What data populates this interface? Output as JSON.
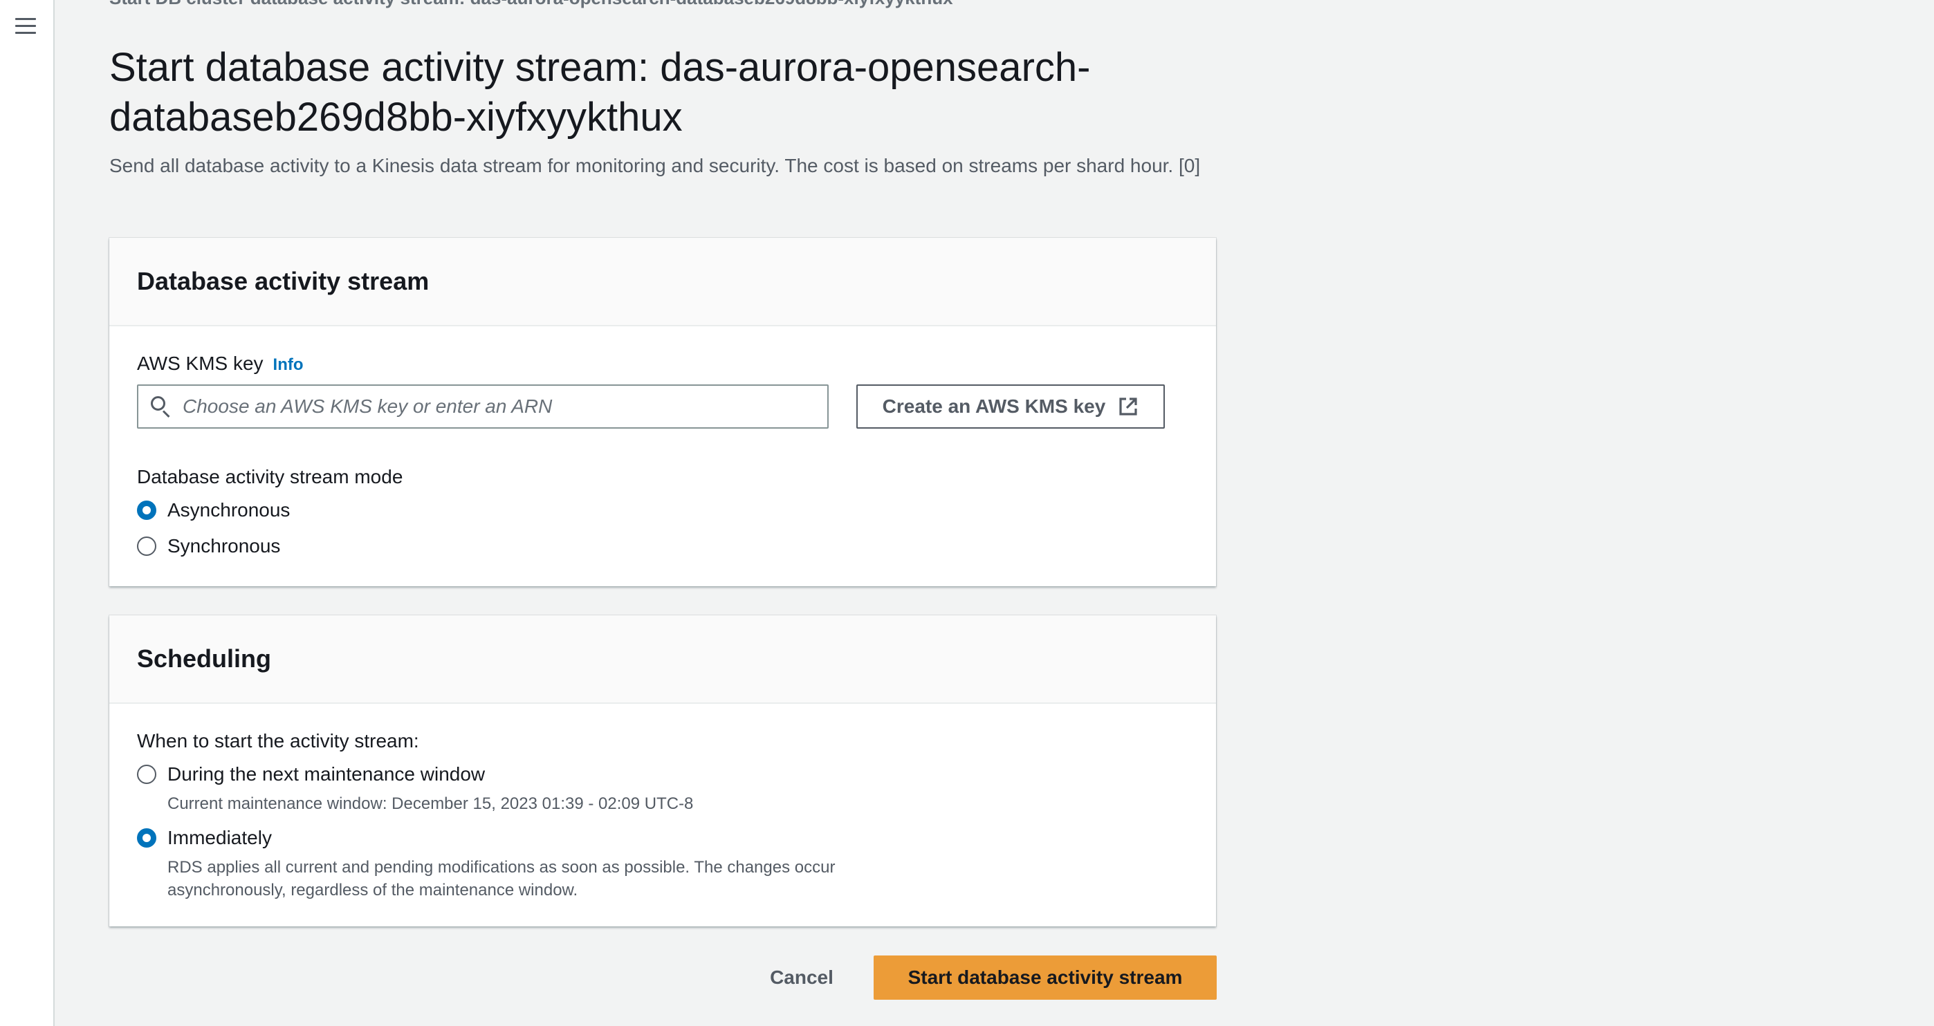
{
  "nav": {
    "menu_icon": "hamburger-menu-icon"
  },
  "breadcrumb_partial": "Start DB cluster database activity stream: das-aurora-opensearch-databaseb269d8bb-xiyfxyykthux",
  "page": {
    "title": "Start database activity stream: das-aurora-opensearch-databaseb269d8bb-xiyfxyykthux",
    "description": "Send all database activity to a Kinesis data stream for monitoring and security. The cost is based on streams per shard hour. [0]"
  },
  "das_panel": {
    "header": "Database activity stream",
    "kms_label": "AWS KMS key",
    "info_label": "Info",
    "kms_placeholder": "Choose an AWS KMS key or enter an ARN",
    "kms_value": "",
    "create_kms_label": "Create an AWS KMS key",
    "mode_label": "Database activity stream mode",
    "modes": [
      {
        "label": "Asynchronous",
        "checked": true
      },
      {
        "label": "Synchronous",
        "checked": false
      }
    ]
  },
  "scheduling_panel": {
    "header": "Scheduling",
    "when_label": "When to start the activity stream:",
    "options": [
      {
        "label": "During the next maintenance window",
        "description": "Current maintenance window: December 15, 2023 01:39 - 02:09 UTC-8",
        "checked": false
      },
      {
        "label": "Immediately",
        "description": "RDS applies all current and pending modifications as soon as possible. The changes occur asynchronously, regardless of the maintenance window.",
        "checked": true
      }
    ]
  },
  "actions": {
    "cancel_label": "Cancel",
    "submit_label": "Start database activity stream"
  },
  "colors": {
    "accent": "#0073bb",
    "primary_button": "#ec9c38",
    "background": "#f2f3f3"
  }
}
